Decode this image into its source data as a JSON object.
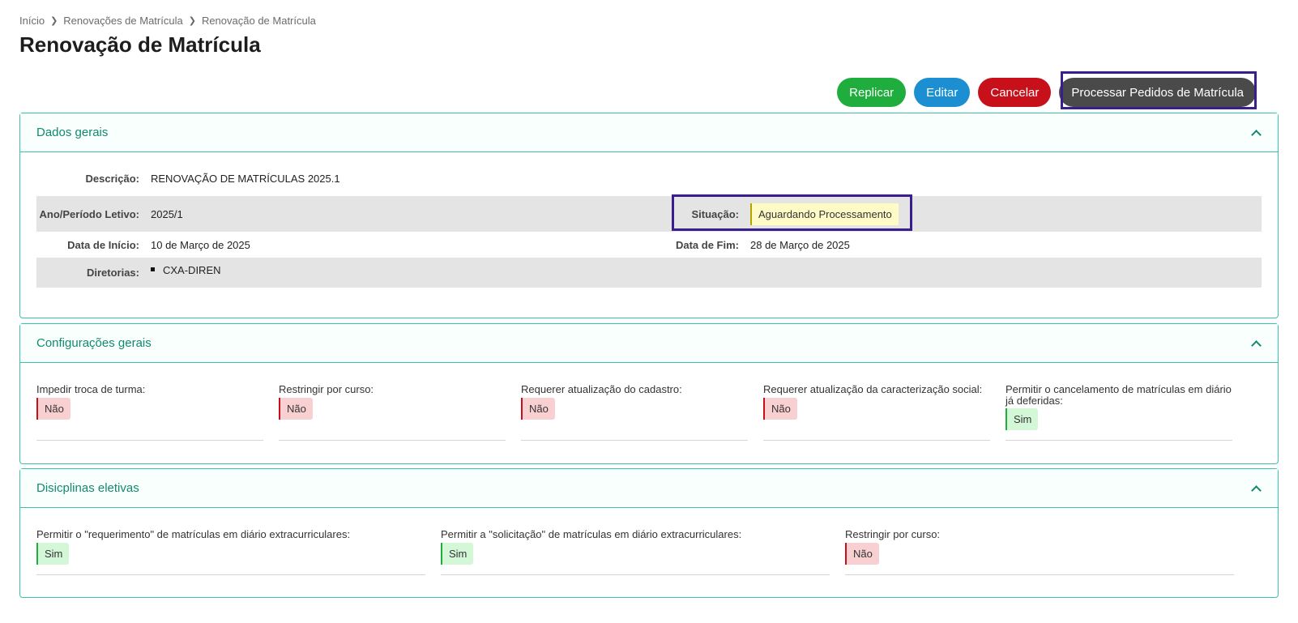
{
  "breadcrumb": [
    "Início",
    "Renovações de Matrícula",
    "Renovação de Matrícula"
  ],
  "page_title": "Renovação de Matrícula",
  "actions": {
    "replicate": "Replicar",
    "edit": "Editar",
    "cancel": "Cancelar",
    "process": "Processar Pedidos de Matrícula"
  },
  "colors": {
    "accent": "#39c3a8",
    "panel_title": "#13896f",
    "highlight": "#3a1e8e"
  },
  "general": {
    "title": "Dados gerais",
    "description_label": "Descrição:",
    "description_value": "RENOVAÇÃO DE MATRÍCULAS 2025.1",
    "period_label": "Ano/Período Letivo:",
    "period_value": "2025/1",
    "status_label": "Situação:",
    "status_value": "Aguardando Processamento",
    "start_label": "Data de Início:",
    "start_value": "10 de Março de 2025",
    "end_label": "Data de Fim:",
    "end_value": "28 de Março de 2025",
    "boards_label": "Diretorias:",
    "boards": [
      "CXA-DIREN"
    ]
  },
  "settings": {
    "title": "Configurações gerais",
    "items": [
      {
        "label": "Impedir troca de turma:",
        "value": "Não"
      },
      {
        "label": "Restringir por curso:",
        "value": "Não"
      },
      {
        "label": "Requerer atualização do cadastro:",
        "value": "Não"
      },
      {
        "label": "Requerer atualização da caracterização social:",
        "value": "Não"
      },
      {
        "label": "Permitir o cancelamento de matrículas em diário já deferidas:",
        "value": "Sim"
      }
    ]
  },
  "electives": {
    "title": "Disicplinas eletivas",
    "items": [
      {
        "label": "Permitir o \"requerimento\" de matrículas em diário extracurriculares:",
        "value": "Sim"
      },
      {
        "label": "Permitir a \"solicitação\" de matrículas em diário extracurriculares:",
        "value": "Sim"
      },
      {
        "label": "Restringir por curso:",
        "value": "Não"
      }
    ]
  }
}
